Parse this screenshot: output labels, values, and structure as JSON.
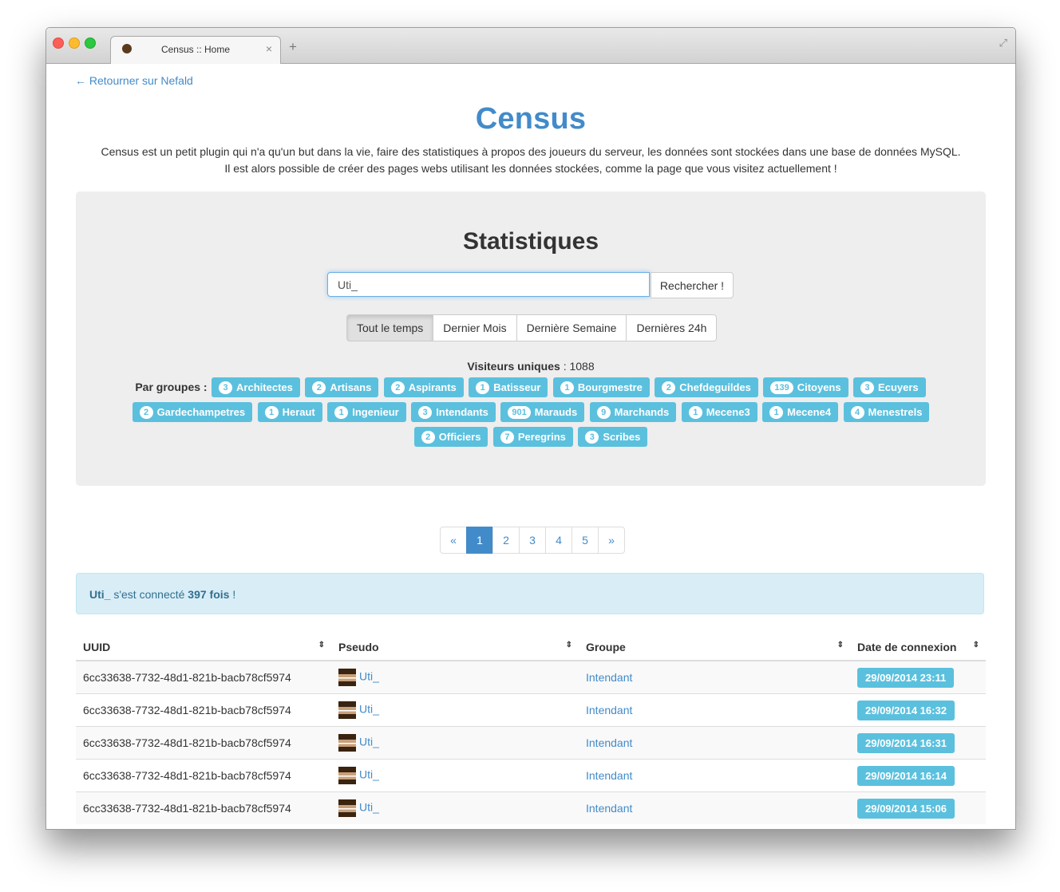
{
  "browser": {
    "tab_title": "Census :: Home",
    "new_tab": "+",
    "tab_close": "×"
  },
  "page": {
    "back_link": "← Retourner sur Nefald",
    "title": "Census",
    "intro_line1": "Census est un petit plugin qui n'a qu'un but dans la vie, faire des statistiques à propos des joueurs du serveur, les données sont stockées dans une base de données MySQL.",
    "intro_line2": "Il est alors possible de créer des pages webs utilisant les données stockées, comme la page que vous visitez actuellement !"
  },
  "stats": {
    "title": "Statistiques",
    "search_value": "Uti_",
    "search_button": "Rechercher !",
    "periods": [
      "Tout le temps",
      "Dernier Mois",
      "Dernière Semaine",
      "Dernières 24h"
    ],
    "active_period": 0,
    "visitors_label": "Visiteurs uniques",
    "visitors_value": ": 1088",
    "groups_label": "Par groupes :",
    "groups": [
      {
        "count": "3",
        "name": "Architectes"
      },
      {
        "count": "2",
        "name": "Artisans"
      },
      {
        "count": "2",
        "name": "Aspirants"
      },
      {
        "count": "1",
        "name": "Batisseur"
      },
      {
        "count": "1",
        "name": "Bourgmestre"
      },
      {
        "count": "2",
        "name": "Chefdeguildes"
      },
      {
        "count": "139",
        "name": "Citoyens"
      },
      {
        "count": "3",
        "name": "Ecuyers"
      },
      {
        "count": "2",
        "name": "Gardechampetres"
      },
      {
        "count": "1",
        "name": "Heraut"
      },
      {
        "count": "1",
        "name": "Ingenieur"
      },
      {
        "count": "3",
        "name": "Intendants"
      },
      {
        "count": "901",
        "name": "Marauds"
      },
      {
        "count": "9",
        "name": "Marchands"
      },
      {
        "count": "1",
        "name": "Mecene3"
      },
      {
        "count": "1",
        "name": "Mecene4"
      },
      {
        "count": "4",
        "name": "Menestrels"
      },
      {
        "count": "2",
        "name": "Officiers"
      },
      {
        "count": "7",
        "name": "Peregrins"
      },
      {
        "count": "3",
        "name": "Scribes"
      }
    ]
  },
  "pagination": {
    "prev": "«",
    "pages": [
      "1",
      "2",
      "3",
      "4",
      "5"
    ],
    "next": "»",
    "active": 0
  },
  "alert": {
    "user": "Uti_",
    "middle": " s'est connecté ",
    "count": "397 fois",
    "end": " !"
  },
  "table": {
    "headers": [
      "UUID",
      "Pseudo",
      "Groupe",
      "Date de connexion"
    ],
    "sort_icon": "⇕",
    "rows": [
      {
        "uuid": "6cc33638-7732-48d1-821b-bacb78cf5974",
        "pseudo": "Uti_",
        "group": "Intendant",
        "date": "29/09/2014 23:11"
      },
      {
        "uuid": "6cc33638-7732-48d1-821b-bacb78cf5974",
        "pseudo": "Uti_",
        "group": "Intendant",
        "date": "29/09/2014 16:32"
      },
      {
        "uuid": "6cc33638-7732-48d1-821b-bacb78cf5974",
        "pseudo": "Uti_",
        "group": "Intendant",
        "date": "29/09/2014 16:31"
      },
      {
        "uuid": "6cc33638-7732-48d1-821b-bacb78cf5974",
        "pseudo": "Uti_",
        "group": "Intendant",
        "date": "29/09/2014 16:14"
      },
      {
        "uuid": "6cc33638-7732-48d1-821b-bacb78cf5974",
        "pseudo": "Uti_",
        "group": "Intendant",
        "date": "29/09/2014 15:06"
      }
    ]
  },
  "colors": {
    "primary": "#428bca",
    "info": "#5bc0de",
    "alert_bg": "#d9edf7"
  }
}
